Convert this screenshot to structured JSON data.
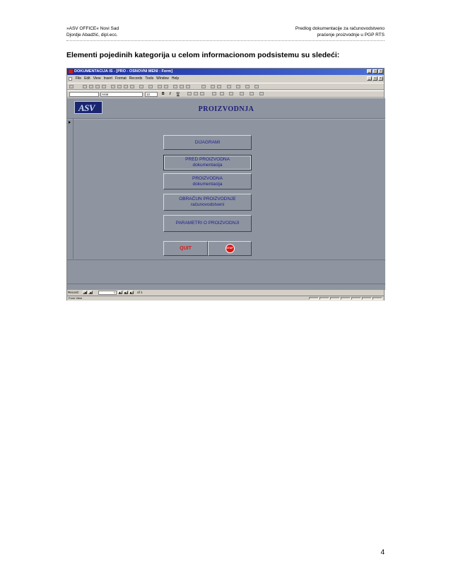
{
  "header": {
    "left_line1": "»ASV OFFICE« Novi Sad",
    "left_line2": "Djordje Abadžić, dipl.ecc.",
    "right_line1": "Predlog dokumentacije za računovodstveno",
    "right_line2": "praćenje proizvodnje u PGP RTS"
  },
  "heading": "Elementi pojedinih kategorija u celom informacionom podsistemu su sledeći:",
  "screenshot": {
    "window_title": "DOKUMENTACIJA IS - [PRO - OSNOVNI MENI : Form]",
    "menus": [
      "File",
      "Edit",
      "View",
      "Insert",
      "Format",
      "Records",
      "Tools",
      "Window",
      "Help"
    ],
    "font_name": "Arial",
    "font_size": "12",
    "format_buttons": [
      "B",
      "I",
      "U"
    ],
    "logo_text": "ASV",
    "form_title": "PROIZVODNJA",
    "buttons": {
      "diagrami": "DIJAGRAMI",
      "pred_line1": "PRED PROIZVODNA",
      "pred_line2": "dokumentacija",
      "proiz_line1": "PROIZVODNA",
      "proiz_line2": "dokumentacija",
      "obracun_line1": "OBRAČUN PROIZVODNJE",
      "obracun_line2": "računovodstveni",
      "parametri": "PARAMETRI O PROIZVODNJI",
      "quit": "QUIT",
      "stop": "STOP"
    },
    "record": {
      "label": "Record:",
      "current": "1",
      "of_label": "of 1"
    },
    "status": "Form View"
  },
  "page_number": "4"
}
